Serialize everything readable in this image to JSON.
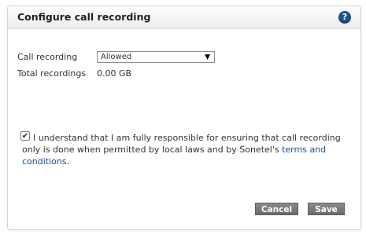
{
  "dialog": {
    "title": "Configure call recording",
    "help_glyph": "?"
  },
  "form": {
    "call_recording_label": "Call recording",
    "call_recording_value": "Allowed",
    "total_recordings_label": "Total recordings",
    "total_recordings_value": "0.00 GB"
  },
  "agreement": {
    "checked": true,
    "text_before_link": "I understand that I am fully responsible for ensuring that call recording only is done when permitted by local laws and by Sonetel's ",
    "link_text": "terms and conditions",
    "text_after_link": "."
  },
  "buttons": {
    "cancel": "Cancel",
    "save": "Save"
  },
  "colors": {
    "help_icon": "#1f4f8a",
    "link": "#1a4f8c",
    "button": "#7a7a7a"
  }
}
